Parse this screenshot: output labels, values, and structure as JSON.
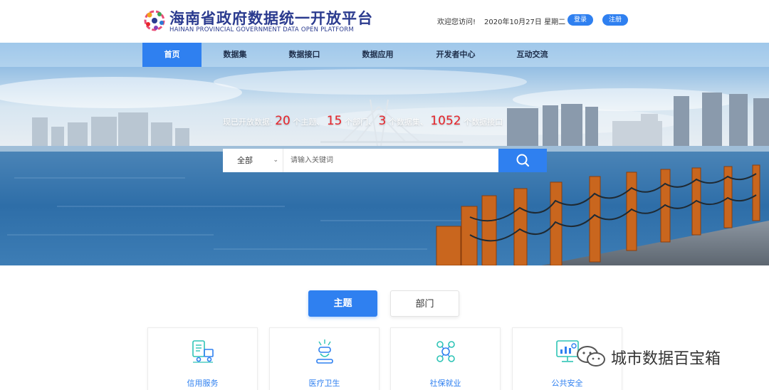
{
  "header": {
    "logo_cn": "海南省政府数据统一开放平台",
    "logo_en": "HAINAN PROVINCIAL GOVERNMENT DATA OPEN PLATFORM",
    "welcome": "欢迎您访问!",
    "date": "2020年10月27日  星期二",
    "login_label": "登录",
    "register_label": "注册"
  },
  "nav": {
    "items": [
      {
        "label": "首页",
        "active": true
      },
      {
        "label": "数据集"
      },
      {
        "label": "数据接口"
      },
      {
        "label": "数据应用"
      },
      {
        "label": "开发者中心"
      },
      {
        "label": "互动交流"
      }
    ]
  },
  "stats": {
    "prefix": "现已开放数据:",
    "topics": "20",
    "topics_unit": "个主题、",
    "departments": "15",
    "departments_unit": "个部门、",
    "datasets": "3",
    "datasets_unit": "个数据集、",
    "apis": "1052",
    "apis_unit": "个数据接口"
  },
  "search": {
    "scope": "全部",
    "placeholder": "请输入关键词",
    "button_icon": "search-icon"
  },
  "tabs": {
    "theme_label": "主题",
    "dept_label": "部门"
  },
  "cards": [
    {
      "label": "信用服务",
      "icon": "credit-truck-icon"
    },
    {
      "label": "医疗卫生",
      "icon": "medical-icon"
    },
    {
      "label": "社保就业",
      "icon": "social-security-icon"
    },
    {
      "label": "公共安全",
      "icon": "public-safety-icon"
    }
  ],
  "watermark": {
    "text": "城市数据百宝箱",
    "icon": "wechat-icon"
  },
  "colors": {
    "primary": "#2f80f0",
    "highlight": "#e8232a",
    "logo": "#2b3b8f",
    "icon_teal": "#2ec4b6"
  }
}
